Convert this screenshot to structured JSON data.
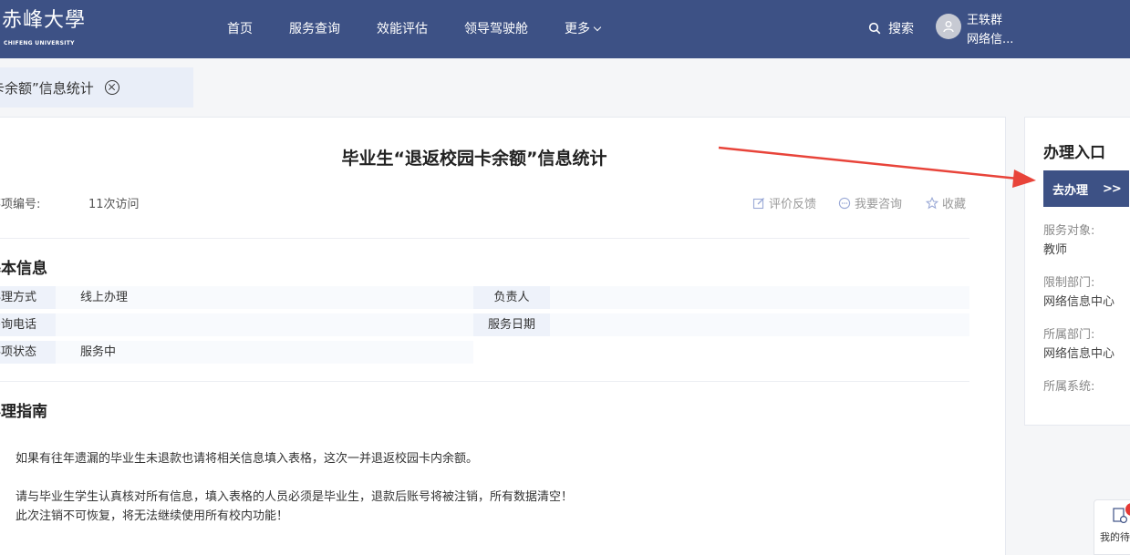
{
  "header": {
    "logo_glyphs": "赤峰大學",
    "logo_subtitle": "CHIFENG UNIVERSITY",
    "nav": [
      "首页",
      "服务查询",
      "效能评估",
      "领导驾驶舱",
      "更多"
    ],
    "search_label": "搜索",
    "user_name": "王轶群",
    "user_dept": "网络信..."
  },
  "tab": {
    "label": "卡余额”信息统计"
  },
  "main": {
    "title": "毕业生“退返校园卡余额”信息统计",
    "code_label": "事项编号:",
    "visits": "11次访问",
    "actions": [
      "评价反馈",
      "我要咨询",
      "收藏"
    ],
    "basic_info_title": "基本信息",
    "info_rows": [
      {
        "label": "办理方式",
        "value": "线上办理"
      },
      {
        "label": "咨询电话",
        "value": ""
      },
      {
        "label": "事项状态",
        "value": "服务中"
      }
    ],
    "info_right": [
      {
        "label": "负责人",
        "value": ""
      },
      {
        "label": "服务日期",
        "value": ""
      }
    ],
    "guide_title": "办理指南",
    "guide_lines": [
      "如果有往年遗漏的毕业生未退款也请将相关信息填入表格，这次一并退返校园卡内余额。",
      "请与毕业生学生认真核对所有信息，填入表格的人员必须是毕业生，退款后账号将被注销，所有数据清空！",
      "此次注销不可恢复，将无法继续使用所有校内功能！"
    ]
  },
  "side": {
    "title": "办理入口",
    "button": "去办理",
    "button_arrow": ">>",
    "fields": [
      {
        "label": "服务对象:",
        "value": "教师"
      },
      {
        "label": "限制部门:",
        "value": "网络信息中心"
      },
      {
        "label": "所属部门:",
        "value": "网络信息中心"
      },
      {
        "label": "所属系统:",
        "value": ""
      }
    ]
  },
  "float_widget": {
    "label": "我的待"
  },
  "colors": {
    "brand": "#3d5185",
    "annotation_arrow": "#e8443a"
  }
}
